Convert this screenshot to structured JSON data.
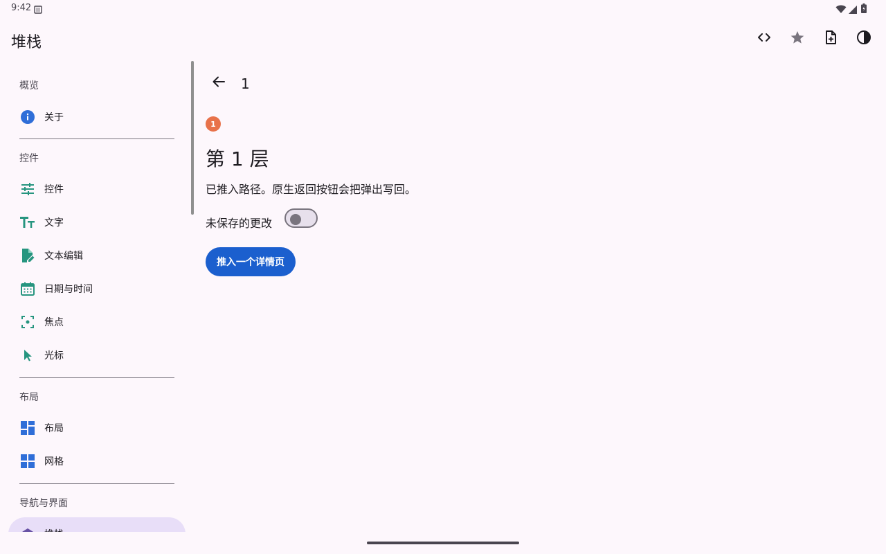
{
  "status_bar": {
    "time": "9:42"
  },
  "app_bar": {
    "title": "堆栈",
    "actions": [
      "code-icon",
      "star-icon",
      "note-add-icon",
      "contrast-icon"
    ]
  },
  "sidebar": {
    "sections": [
      {
        "title": "概览",
        "items": [
          {
            "label": "关于",
            "icon": "info-icon"
          }
        ]
      },
      {
        "title": "控件",
        "items": [
          {
            "label": "控件",
            "icon": "tune-icon"
          },
          {
            "label": "文字",
            "icon": "text-fields-icon"
          },
          {
            "label": "文本编辑",
            "icon": "edit-document-icon"
          },
          {
            "label": "日期与时间",
            "icon": "calendar-icon"
          },
          {
            "label": "焦点",
            "icon": "focus-icon"
          },
          {
            "label": "光标",
            "icon": "cursor-icon"
          }
        ]
      },
      {
        "title": "布局",
        "items": [
          {
            "label": "布局",
            "icon": "dashboard-icon"
          },
          {
            "label": "网格",
            "icon": "grid-icon"
          }
        ]
      },
      {
        "title": "导航与界面",
        "items": [
          {
            "label": "堆栈",
            "icon": "stack-icon",
            "active": true
          }
        ]
      }
    ]
  },
  "content": {
    "title": "1",
    "badge": "1",
    "heading": "第 1 层",
    "description": "已推入路径。原生返回按钮会把弹出写回。",
    "switch_label": "未保存的更改",
    "switch_on": false,
    "push_button": "推入一个详情页"
  },
  "colors": {
    "background": "#fdf7fc",
    "accent_blue": "#1b5fce",
    "badge_orange": "#e8724a",
    "teal_icon": "#26957f",
    "blue_icon": "#2f6ed8",
    "active_bg": "#e8def8"
  }
}
